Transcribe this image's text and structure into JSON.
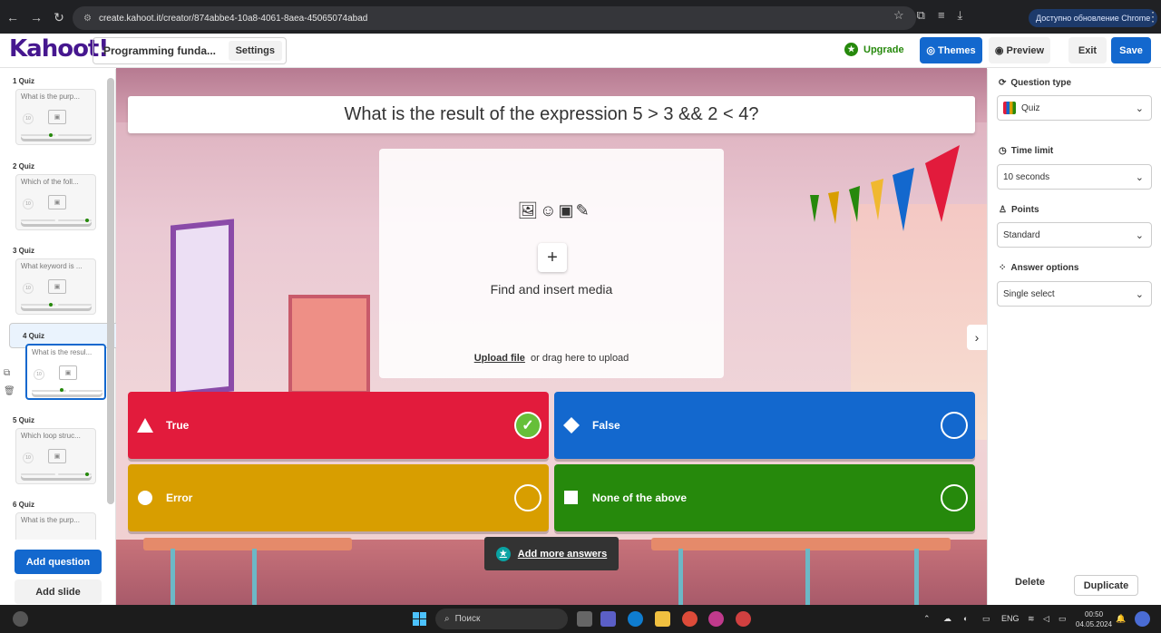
{
  "browser": {
    "url": "create.kahoot.it/creator/874abbe4-10a8-4061-8aea-45065074abad",
    "update_label": "Доступно обновление Chrome"
  },
  "header": {
    "logo": "Kahoot!",
    "title": "Programming funda...",
    "settings_label": "Settings",
    "upgrade_label": "Upgrade",
    "themes_label": "Themes",
    "preview_label": "Preview",
    "exit_label": "Exit",
    "save_label": "Save"
  },
  "sidebar": {
    "slides": [
      {
        "label": "1 Quiz",
        "question": "What is the purp..."
      },
      {
        "label": "2 Quiz",
        "question": "Which of the foll..."
      },
      {
        "label": "3 Quiz",
        "question": "What keyword is ..."
      },
      {
        "label": "4 Quiz",
        "question": "What is the resul..."
      },
      {
        "label": "5 Quiz",
        "question": "Which loop struc..."
      },
      {
        "label": "6 Quiz",
        "question": "What is the purp..."
      }
    ],
    "timer_value": "10",
    "add_question_label": "Add question",
    "add_slide_label": "Add slide"
  },
  "editor": {
    "question": "What is the result of the expression 5 > 3 && 2 < 4?",
    "media_label": "Find and insert media",
    "upload_link": "Upload file",
    "upload_hint": "or drag here to upload",
    "answers": [
      {
        "text": "True",
        "color": "#e21b3c",
        "shape": "triangle",
        "correct": true
      },
      {
        "text": "False",
        "color": "#1368ce",
        "shape": "diamond",
        "correct": false
      },
      {
        "text": "Error",
        "color": "#d89e00",
        "shape": "circle",
        "correct": false
      },
      {
        "text": "None of the above",
        "color": "#26890c",
        "shape": "square",
        "correct": false
      }
    ],
    "add_more_label": "Add more answers"
  },
  "settings_panel": {
    "question_type_label": "Question type",
    "question_type_value": "Quiz",
    "time_limit_label": "Time limit",
    "time_limit_value": "10 seconds",
    "points_label": "Points",
    "points_value": "Standard",
    "answer_options_label": "Answer options",
    "answer_options_value": "Single select",
    "delete_label": "Delete",
    "duplicate_label": "Duplicate"
  },
  "taskbar": {
    "search_placeholder": "Поиск",
    "language": "ENG",
    "time": "00:50",
    "date": "04.05.2024"
  },
  "colors": {
    "brand": "#46178f",
    "primary": "#1368ce",
    "correct": "#66bf39"
  }
}
